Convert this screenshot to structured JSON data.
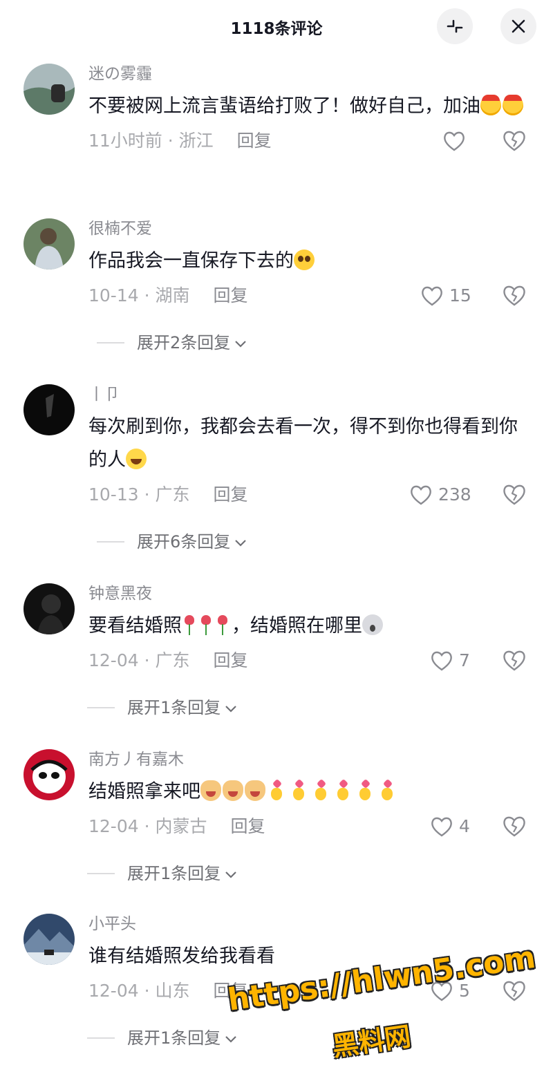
{
  "header": {
    "title": "1118条评论"
  },
  "comments": [
    {
      "username": "迷の雾霾",
      "text": "不要被网上流言蜚语给打败了！做好自己，加油",
      "emojis": [
        "angry",
        "angry"
      ],
      "time": "11小时前",
      "region": "浙江",
      "reply": "回复",
      "likes": "",
      "expand": "",
      "avatar_colors": [
        "#6f8a7c",
        "#b8c2c4"
      ]
    },
    {
      "username": "很楠不爱",
      "text": "作品我会一直保存下去的",
      "emojis": [
        "shy"
      ],
      "time": "10-14",
      "region": "湖南",
      "reply": "回复",
      "likes": "15",
      "expand": "展开2条回复",
      "avatar_colors": [
        "#5f7a5a",
        "#d6d1c4"
      ]
    },
    {
      "username": "丨卩",
      "text": "每次刷到你，我都会去看一次，得不到你也得看到你的人",
      "emojis": [
        "grin"
      ],
      "time": "10-13",
      "region": "广东",
      "reply": "回复",
      "likes": "238",
      "expand": "展开6条回复",
      "avatar_colors": [
        "#0b0b0b",
        "#3a3a3a"
      ]
    },
    {
      "username": "钟意黑夜",
      "text_before": "要看结婚照",
      "text_after": "，结婚照在哪里",
      "emojis": [
        "rose",
        "rose",
        "rose"
      ],
      "emojis_after": [
        "shock"
      ],
      "time": "12-04",
      "region": "广东",
      "reply": "回复",
      "likes": "7",
      "expand": "展开1条回复",
      "avatar_colors": [
        "#111111",
        "#404040"
      ]
    },
    {
      "username": "南方丿有嘉木",
      "text": "结婚照拿来吧",
      "emojis": [
        "dog",
        "dog",
        "dog",
        "heart",
        "heart",
        "heart",
        "heart",
        "heart",
        "heart"
      ],
      "time": "12-04",
      "region": "内蒙古",
      "reply": "回复",
      "likes": "4",
      "expand": "展开1条回复",
      "avatar_colors": [
        "#c8102e",
        "#ffffff"
      ]
    },
    {
      "username": "小平头",
      "text": "谁有结婚照发给我看看",
      "emojis": [],
      "time": "12-04",
      "region": "山东",
      "reply": "回复",
      "likes": "5",
      "expand": "展开1条回复",
      "avatar_colors": [
        "#2c3e5a",
        "#c9d6e3"
      ]
    }
  ],
  "watermark": {
    "url": "https://hlwn5.com",
    "name": "黑料网"
  }
}
